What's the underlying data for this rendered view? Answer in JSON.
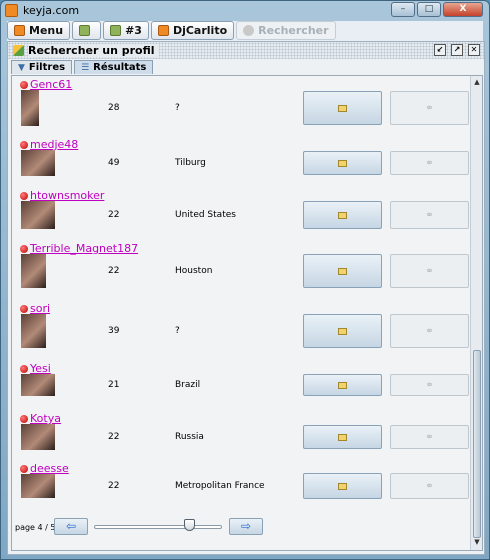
{
  "window": {
    "title": "keyja.com",
    "min": "–",
    "max": "□",
    "close": "X"
  },
  "toolbar": {
    "menu": "Menu",
    "item2": "",
    "item3": "#3",
    "item4": "DjCarlito",
    "item5": "Rechercher"
  },
  "frame": {
    "title": "Rechercher un profil",
    "ctrl1": "↙",
    "ctrl2": "↗",
    "ctrl3": "✕"
  },
  "tabs": [
    {
      "label": "Filtres",
      "icon": "funnel-icon"
    },
    {
      "label": "Résultats",
      "icon": "list-icon"
    }
  ],
  "results": [
    {
      "username": "Genc61",
      "age": "28",
      "city": "?"
    },
    {
      "username": "medje48",
      "age": "49",
      "city": "Tilburg"
    },
    {
      "username": "htownsmoker",
      "age": "22",
      "city": "United States"
    },
    {
      "username": "Terrible_Magnet187",
      "age": "22",
      "city": "Houston"
    },
    {
      "username": "sori",
      "age": "39",
      "city": "?"
    },
    {
      "username": "Yesi",
      "age": "21",
      "city": "Brazil"
    },
    {
      "username": "Kotya",
      "age": "22",
      "city": "Russia"
    },
    {
      "username": "deesse",
      "age": "22",
      "city": "Metropolitan France"
    }
  ],
  "pager": {
    "label": "page 4 / 5",
    "prev": "⇦",
    "next": "⇨",
    "position": 0.75
  },
  "colors": {
    "username": "#c000c0",
    "status_offline": "#c10000",
    "accent": "#f08a24"
  }
}
